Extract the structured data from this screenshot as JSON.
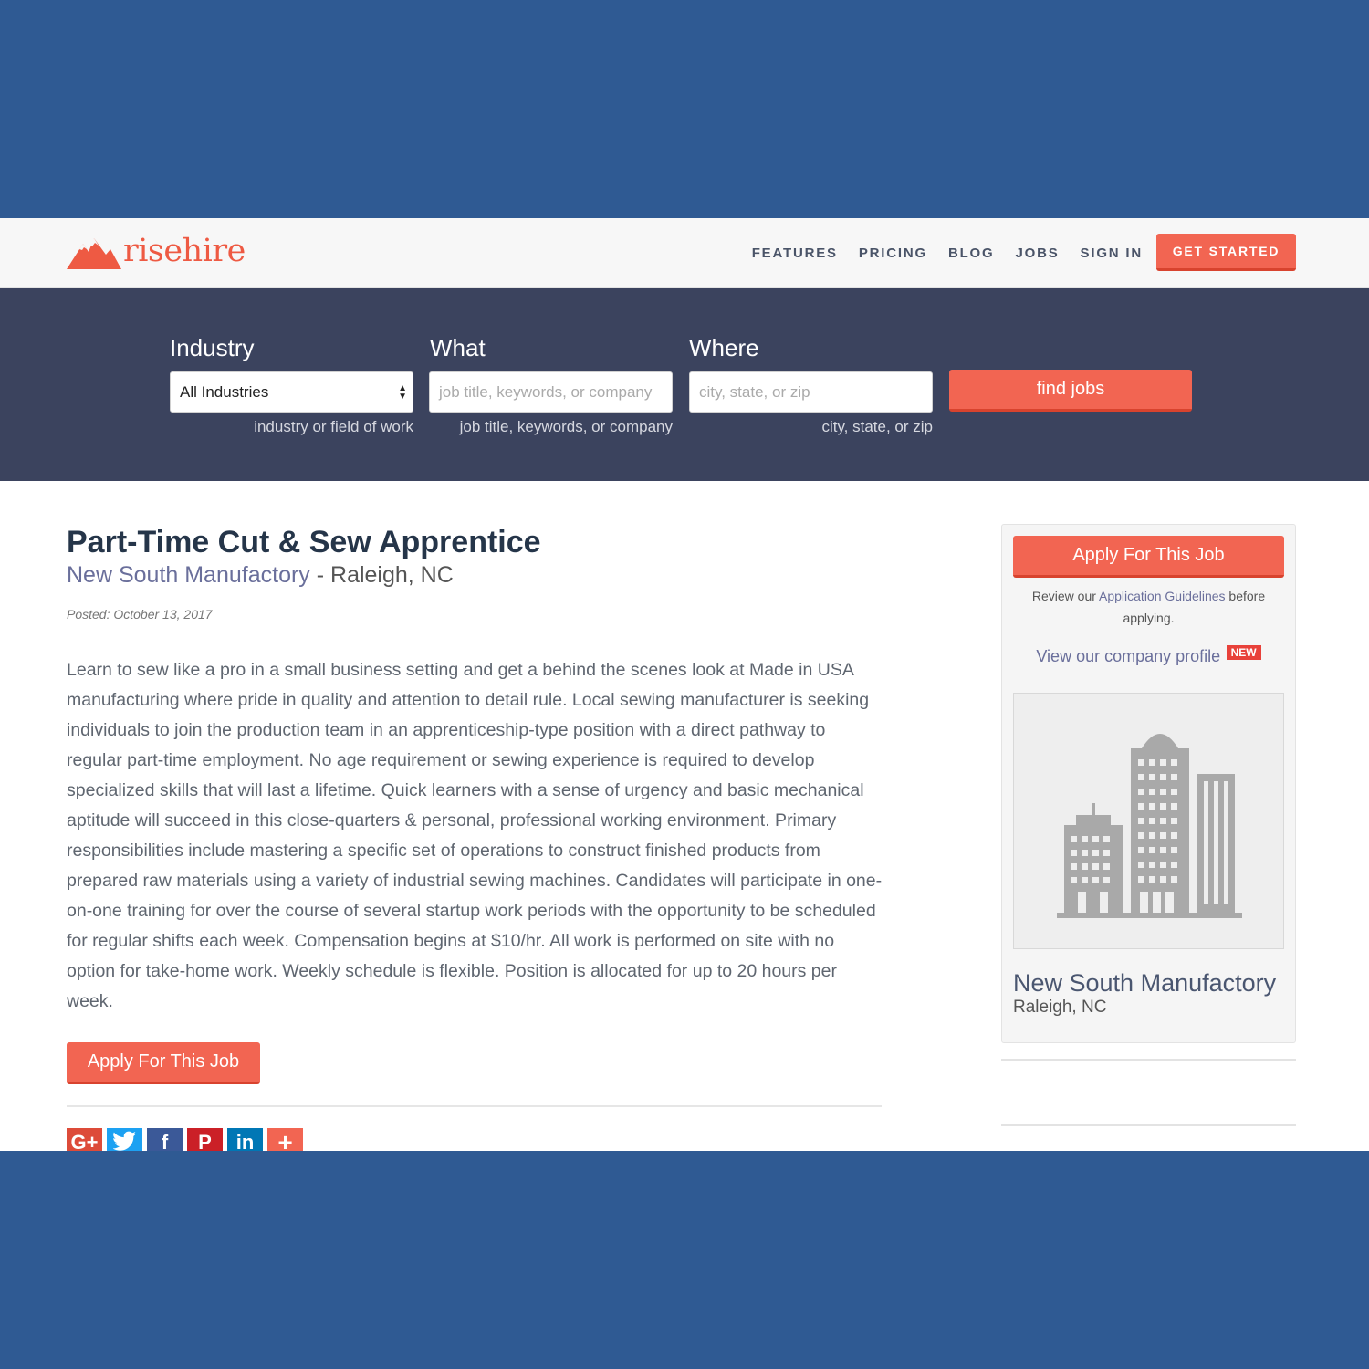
{
  "brand": {
    "name": "risehire",
    "color": "#ee5a43"
  },
  "nav": {
    "items": [
      "FEATURES",
      "PRICING",
      "BLOG",
      "JOBS",
      "SIGN IN"
    ],
    "cta": "GET STARTED"
  },
  "search": {
    "industry": {
      "label": "Industry",
      "selected": "All Industries",
      "hint": "industry or field of work"
    },
    "what": {
      "label": "What",
      "placeholder": "job title, keywords, or company",
      "hint": "job title, keywords, or company"
    },
    "where": {
      "label": "Where",
      "placeholder": "city, state, or zip",
      "hint": "city, state, or zip"
    },
    "button": "find jobs"
  },
  "job": {
    "title": "Part-Time Cut & Sew Apprentice",
    "company": "New South Manufactory",
    "separator": " - ",
    "location": "Raleigh, NC",
    "posted": "Posted: October 13, 2017",
    "description": "Learn to sew like a pro in a small business setting and get a behind the scenes look at Made in USA manufacturing where pride in quality and attention to detail rule. Local sewing manufacturer is seeking individuals to join the production team in an apprenticeship-type position with a direct pathway to regular part-time employment. No age requirement or sewing experience is required to develop specialized skills that will last a lifetime. Quick learners with a sense of urgency and basic mechanical aptitude will succeed in this close-quarters & personal, professional working environment. Primary responsibilities include mastering a specific set of operations to construct finished products from prepared raw materials using a variety of industrial sewing machines. Candidates will participate in one-on-one training for over the course of several startup work periods with the opportunity to be scheduled for regular shifts each week. Compensation begins at $10/hr. All work is performed on site with no option for take-home work. Weekly schedule is flexible. Position is allocated for up to 20 hours per week.",
    "apply_label": "Apply For This Job"
  },
  "share": [
    {
      "icon": "google-plus-icon",
      "glyph": "G+",
      "color": "#dd4b39"
    },
    {
      "icon": "twitter-icon",
      "glyph": "🐦",
      "color": "#1da1f2"
    },
    {
      "icon": "facebook-icon",
      "glyph": "f",
      "color": "#3b5998"
    },
    {
      "icon": "pinterest-icon",
      "glyph": "P",
      "color": "#cb2027"
    },
    {
      "icon": "linkedin-icon",
      "glyph": "in",
      "color": "#0077b5"
    },
    {
      "icon": "more-share-icon",
      "glyph": "+",
      "color": "#f26552"
    }
  ],
  "sidebar": {
    "apply_label": "Apply For This Job",
    "review_prefix": "Review our ",
    "review_link": "Application Guidelines",
    "review_suffix": " before applying.",
    "profile_link": "View our company profile",
    "badge": "NEW",
    "company_name": "New South Manufactory",
    "company_location": "Raleigh, NC",
    "image_icon": "building-icon"
  },
  "colors": {
    "accent": "#f26552",
    "band": "#3b435e",
    "outer": "#2f5a93"
  }
}
